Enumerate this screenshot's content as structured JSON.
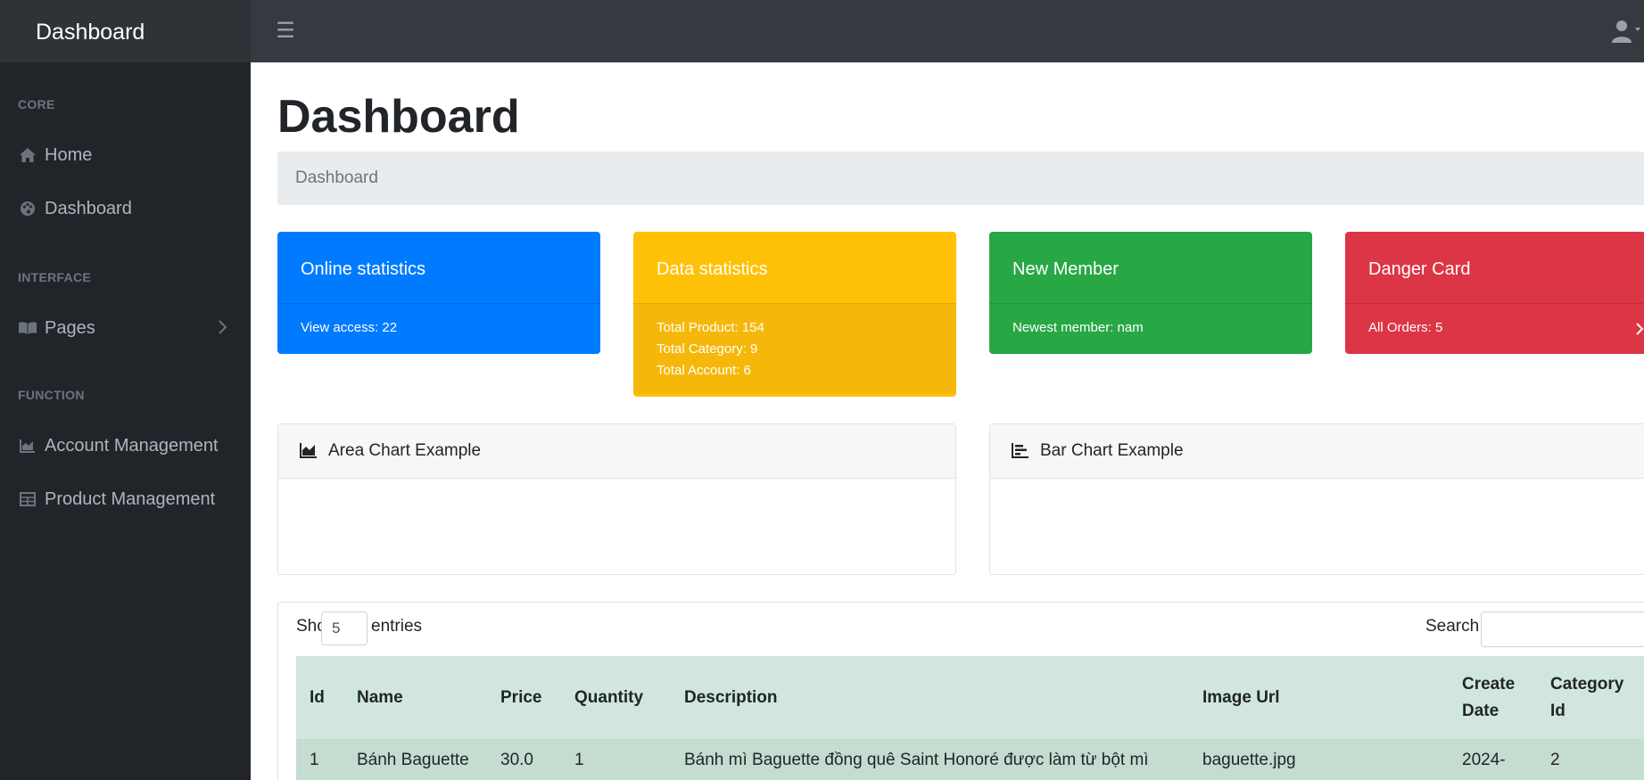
{
  "navbar": {
    "brand": "Dashboard",
    "toggle_icon": "bars-icon",
    "user_icon": "user-icon"
  },
  "sidebar": {
    "sections": [
      {
        "heading": "CORE"
      },
      {
        "heading": "INTERFACE"
      },
      {
        "heading": "FUNCTION"
      }
    ],
    "items": [
      {
        "label": "Home",
        "icon": "home-icon"
      },
      {
        "label": "Dashboard",
        "icon": "palette-icon"
      },
      {
        "label": "Pages",
        "icon": "book-icon"
      },
      {
        "label": "Account Management",
        "icon": "chart-area-icon"
      },
      {
        "label": "Product Management",
        "icon": "table-icon"
      }
    ]
  },
  "page": {
    "title": "Dashboard",
    "breadcrumb": "Dashboard"
  },
  "cards": [
    {
      "title": "Online statistics",
      "lines": [
        "View access: 22"
      ],
      "color": "#007bff"
    },
    {
      "title": "Data statistics",
      "lines": [
        "Total Product: 154",
        "Total Category: 9",
        "Total Account: 6"
      ],
      "color": "#ffc107"
    },
    {
      "title": "New Member",
      "lines": [
        "Newest member: nam"
      ],
      "color": "#28a745"
    },
    {
      "title": "Danger Card",
      "lines": [
        "All Orders: 5"
      ],
      "color": "#dc3545"
    }
  ],
  "panels": {
    "area_title": "Area Chart Example",
    "bar_title": "Bar Chart Example"
  },
  "table": {
    "show_label": "Show",
    "entries_value": "5",
    "entries_label": "entries",
    "search_label": "Search:",
    "columns": [
      "Id",
      "Name",
      "Price",
      "Quantity",
      "Description",
      "Image Url",
      "Create Date",
      "Category Id"
    ],
    "rows": [
      [
        "1",
        "Bánh Baguette",
        "30.0",
        "1",
        "Bánh mì Baguette đồng quê Saint Honoré được làm từ bột mì",
        "baguette.jpg",
        "2024-",
        "2"
      ]
    ]
  }
}
